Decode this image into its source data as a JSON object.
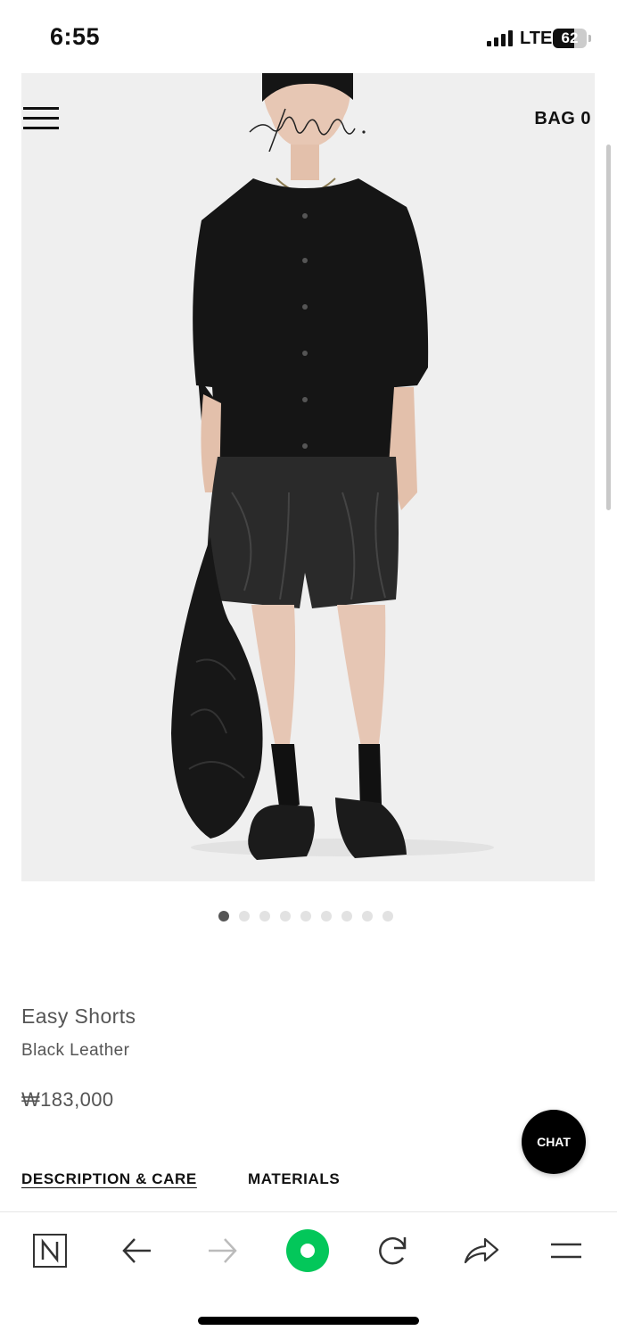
{
  "status_bar": {
    "time": "6:55",
    "network": "LTE",
    "battery": "62"
  },
  "header": {
    "bag_label": "BAG 0",
    "logo_text": "youth."
  },
  "gallery": {
    "count": 9,
    "active_index": 0
  },
  "product": {
    "name": "Easy Shorts",
    "color": "Black Leather",
    "price": "₩183,000"
  },
  "tabs": [
    "DESCRIPTION & CARE",
    "MATERIALS"
  ],
  "chat": {
    "label": "CHAT"
  },
  "toolbar": {
    "icons": [
      "naver-n-icon",
      "back-arrow-icon",
      "forward-arrow-icon",
      "green-dot-icon",
      "reload-icon",
      "share-icon",
      "menu-icon"
    ],
    "accent": "#03c75a"
  }
}
